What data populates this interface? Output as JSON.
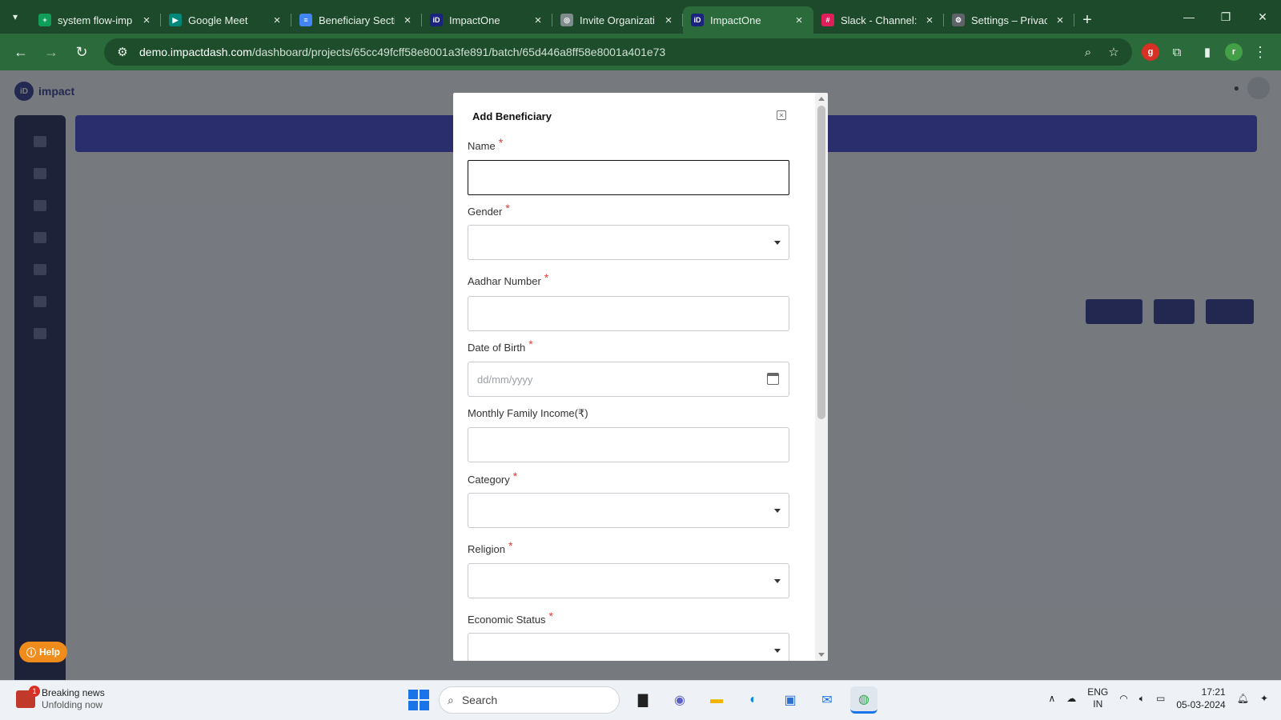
{
  "browser": {
    "tabs": [
      {
        "title": "system flow-imp",
        "icon": "sheets-icon",
        "color": "#0f9d58",
        "glyph": "+",
        "active": false
      },
      {
        "title": "Google Meet",
        "icon": "meet-icon",
        "color": "#00897b",
        "glyph": "▶",
        "active": false
      },
      {
        "title": "Beneficiary Secti",
        "icon": "docs-icon",
        "color": "#4285f4",
        "glyph": "≡",
        "active": false
      },
      {
        "title": "ImpactOne",
        "icon": "impactone-icon",
        "color": "#1a237e",
        "glyph": "iD",
        "active": false
      },
      {
        "title": "Invite Organizati",
        "icon": "openai-icon",
        "color": "#7f8c8d",
        "glyph": "◎",
        "active": false
      },
      {
        "title": "ImpactOne",
        "icon": "impactone-icon",
        "color": "#1a237e",
        "glyph": "iD",
        "active": true
      },
      {
        "title": "Slack - Channel:",
        "icon": "slack-icon",
        "color": "#e01e5a",
        "glyph": "#",
        "active": false
      },
      {
        "title": "Settings – Privac",
        "icon": "gear-icon",
        "color": "#5f6368",
        "glyph": "⚙",
        "active": false
      }
    ],
    "url_host": "demo.impactdash.com",
    "url_path": "/dashboard/projects/65cc49fcff58e8001a3fe891/batch/65d446a8ff58e8001a401e73"
  },
  "modal": {
    "title": "Add Beneficiary",
    "close_glyph": "×",
    "fields": {
      "name": {
        "label": "Name",
        "required": "*"
      },
      "gender": {
        "label": "Gender",
        "required": "*"
      },
      "aadhar": {
        "label": "Aadhar Number",
        "required": "*"
      },
      "dob": {
        "label": "Date of Birth",
        "required": "*",
        "placeholder": "dd/mm/yyyy"
      },
      "income": {
        "label": "Monthly Family Income(₹)"
      },
      "category": {
        "label": "Category",
        "required": "*"
      },
      "religion": {
        "label": "Religion",
        "required": "*"
      },
      "economic": {
        "label": "Economic Status",
        "required": "*"
      }
    }
  },
  "app": {
    "help_label": "Help"
  },
  "taskbar": {
    "news_title": "Breaking news",
    "news_sub": "Unfolding now",
    "news_badge": "1",
    "search_label": "Search",
    "lang_top": "ENG",
    "lang_bottom": "IN",
    "time": "17:21",
    "date": "05-03-2024"
  }
}
